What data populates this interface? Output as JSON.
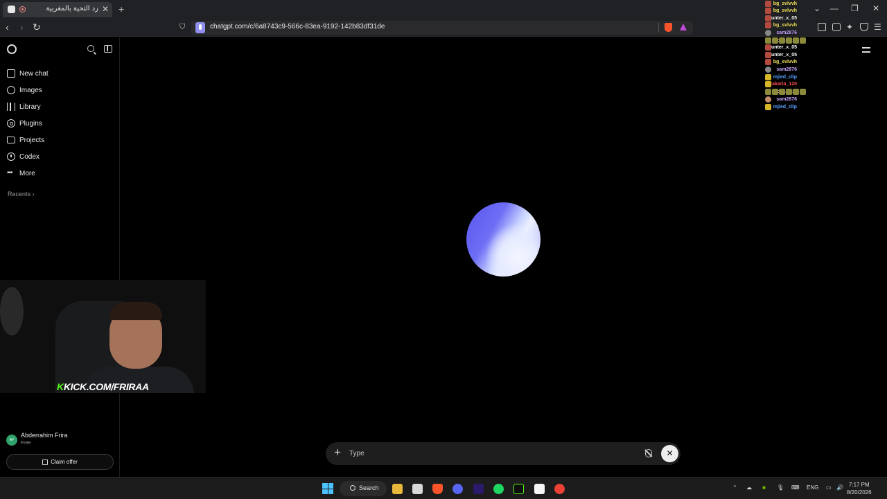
{
  "browser": {
    "tab_title": "رد التحية بالمغربية",
    "new_tab": "+",
    "tab_close": "✕",
    "url": "chatgpt.com/c/6a8743c9-566c-83ea-9192-142b83df31de",
    "window_controls": [
      "⌄",
      "—",
      "❐",
      "✕"
    ]
  },
  "sidebar": {
    "items": [
      {
        "label": "New chat",
        "icon": "new-chat-icon"
      },
      {
        "label": "Images",
        "icon": "images-icon"
      },
      {
        "label": "Library",
        "icon": "library-icon"
      },
      {
        "label": "Plugins",
        "icon": "plugins-icon"
      },
      {
        "label": "Projects",
        "icon": "folder-icon"
      },
      {
        "label": "Codex",
        "icon": "codex-icon"
      },
      {
        "label": "More",
        "icon": "more-icon"
      }
    ],
    "recents": "Recents ›",
    "user": {
      "initials": "AF",
      "name": "Abderrahim Frira",
      "plan": "Free"
    },
    "claim_offer": "Claim offer"
  },
  "stream": {
    "kick_prefix": "K",
    "kick_label": "KICK.COM/FRIRAA",
    "chat": [
      {
        "user": "bg_svlvvh",
        "color": "#f5e663"
      },
      {
        "user": "bg_svlvvh",
        "color": "#f5e663"
      },
      {
        "user": "Hunter_x_05",
        "color": "#ffffff"
      },
      {
        "user": "bg_svlvvh",
        "color": "#f5e663"
      },
      {
        "user": "sam2876",
        "color": "#c9a6ff"
      },
      {
        "user": "chalokhi",
        "color": "#ffb3c7"
      },
      {
        "user": "Hunter_x_05",
        "color": "#ffffff"
      },
      {
        "user": "Hunter_x_05",
        "color": "#ffffff"
      },
      {
        "user": "bg_svlvvh",
        "color": "#f5e663"
      },
      {
        "user": "sam2876",
        "color": "#c9a6ff"
      },
      {
        "user": "mjied_clip",
        "color": "#5aa0ff"
      },
      {
        "user": "zakaria_120",
        "color": "#ff4d4d"
      },
      {
        "user": "chalokhi",
        "color": "#ffb3c7"
      },
      {
        "user": "sam2876",
        "color": "#c9a6ff"
      },
      {
        "user": "mjied_clip",
        "color": "#5aa0ff"
      }
    ]
  },
  "composer": {
    "placeholder": "Type",
    "plus": "+",
    "end": "✕"
  },
  "taskbar": {
    "search": "Search",
    "lang": "ENG",
    "time": "7:17 PM",
    "date": "8/20/2026"
  }
}
